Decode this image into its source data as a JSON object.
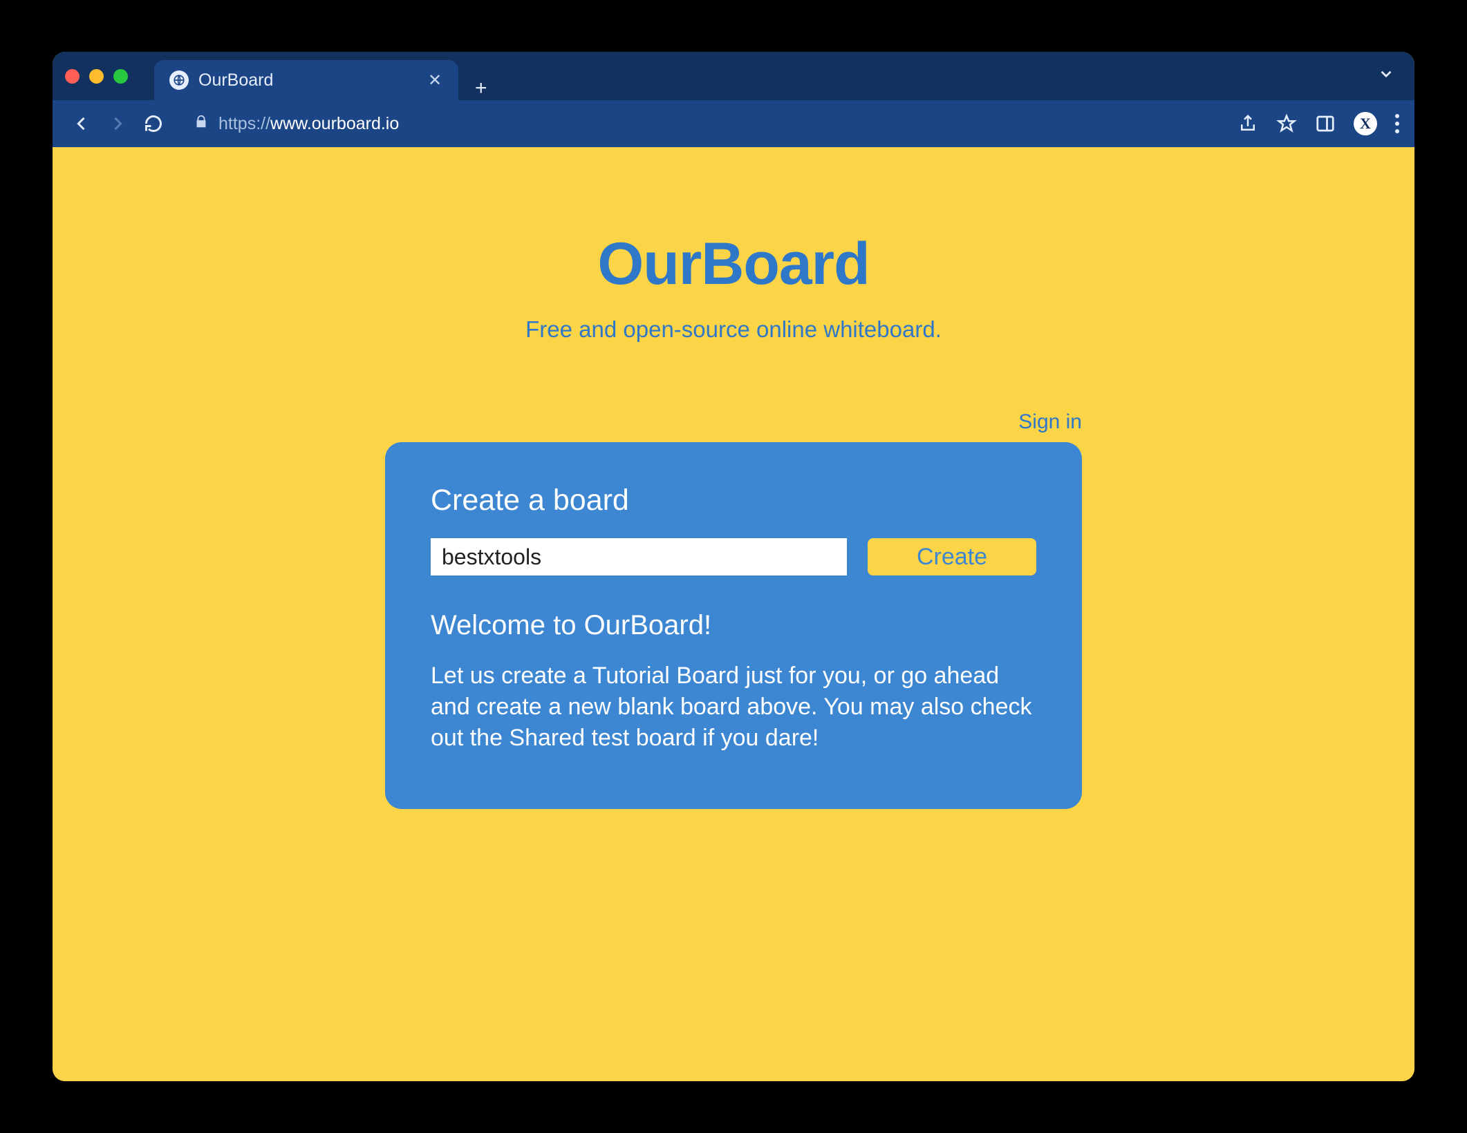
{
  "browser": {
    "tab_title": "OurBoard",
    "url_scheme": "https://",
    "url_host": "www.ourboard.io",
    "url_path": "",
    "profile_letter": "X"
  },
  "page": {
    "logo": "OurBoard",
    "tagline": "Free and open-source online whiteboard.",
    "signin": "Sign in",
    "card": {
      "heading": "Create a board",
      "input_value": "bestxtools",
      "create_label": "Create",
      "welcome_heading": "Welcome to OurBoard!",
      "welcome_body": "Let us create a Tutorial Board just for you, or go ahead and create a new blank board above. You may also check out the Shared test board if you dare!"
    }
  },
  "colors": {
    "brand_yellow": "#fbd448",
    "brand_blue": "#3d86d2",
    "text_blue": "#2f77c8",
    "chrome_dark": "#13315f",
    "chrome_mid": "#1c4585"
  }
}
